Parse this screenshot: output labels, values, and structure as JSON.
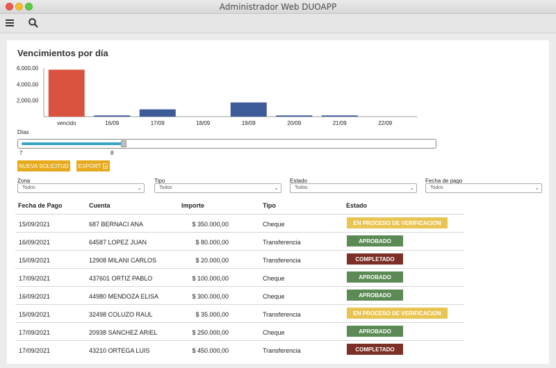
{
  "window": {
    "title": "Administrador Web DUOAPP"
  },
  "toolbar": {
    "menu_icon": "hamburger-icon",
    "search_icon": "search-icon"
  },
  "card": {
    "title": "Vencimientos por día"
  },
  "chart_data": {
    "type": "bar",
    "categories": [
      "vencido",
      "16/09",
      "17/09",
      "18/09",
      "19/09",
      "20/09",
      "21/09",
      "22/09"
    ],
    "values": [
      5800,
      150,
      900,
      0,
      1750,
      150,
      150,
      0
    ],
    "colors": [
      "#d9533f",
      "#3d5a99",
      "#3d5a99",
      "#3d5a99",
      "#3d5a99",
      "#3d5a99",
      "#3d5a99",
      "#3d5a99"
    ],
    "yticks": [
      {
        "value": 2000,
        "label": "2,000,00"
      },
      {
        "value": 4000,
        "label": "4,000,00"
      },
      {
        "value": 6000,
        "label": "6,000,00"
      }
    ],
    "ylim": [
      0,
      6000
    ],
    "grid": false,
    "legend": "none"
  },
  "slider": {
    "label": "Días",
    "min_label": "7",
    "max_label": "8",
    "fill_fraction": 0.24
  },
  "actions": {
    "new_request": "NUEVA SOLICITUD",
    "export": "EXPORT",
    "export_icon": "file-icon"
  },
  "filters": [
    {
      "label": "Zona",
      "value": "Todos"
    },
    {
      "label": "Tipo",
      "value": "Todos"
    },
    {
      "label": "Estado",
      "value": "Todos"
    },
    {
      "label": "Fecha de pago",
      "value": "Todos"
    }
  ],
  "table": {
    "headers": [
      "Fecha de Pago",
      "Cuenta",
      "Importe",
      "Tipo",
      "Estado"
    ],
    "rows": [
      {
        "fecha": "15/09/2021",
        "cuenta": "687 BERNACI ANA",
        "importe": "$ 350.000,00",
        "tipo": "Cheque",
        "estado": "EN PROCESO DE VERIFICACION",
        "estado_color": "#e9c453"
      },
      {
        "fecha": "16/09/2021",
        "cuenta": "64587 LOPEZ JUAN",
        "importe": "$ 80.000,00",
        "tipo": "Transferencia",
        "estado": "APROBADO",
        "estado_color": "#5b8a55"
      },
      {
        "fecha": "15/09/2021",
        "cuenta": "12908 MILANI CARLOS",
        "importe": "$ 20.000,00",
        "tipo": "Transferencia",
        "estado": "COMPLETADO",
        "estado_color": "#7c2f26"
      },
      {
        "fecha": "17/09/2021",
        "cuenta": "437601 ORTIZ PABLO",
        "importe": "$ 100.000,00",
        "tipo": "Cheque",
        "estado": "APROBADO",
        "estado_color": "#5b8a55"
      },
      {
        "fecha": "16/09/2021",
        "cuenta": "44980 MENDOZA ELISA",
        "importe": "$ 300.000,00",
        "tipo": "Cheque",
        "estado": "APROBADO",
        "estado_color": "#5b8a55"
      },
      {
        "fecha": "15/09/2021",
        "cuenta": "32498 COLUZO RAUL",
        "importe": "$ 35.000,00",
        "tipo": "Transferencia",
        "estado": "EN PROCESO DE VERIFICACION",
        "estado_color": "#e9c453"
      },
      {
        "fecha": "17/09/2021",
        "cuenta": "20938 SANCHEZ ARIEL",
        "importe": "$ 250.000,00",
        "tipo": "Cheque",
        "estado": "APROBADO",
        "estado_color": "#5b8a55"
      },
      {
        "fecha": "17/09/2021",
        "cuenta": "43210 ORTEGA LUIS",
        "importe": "$ 450.000,00",
        "tipo": "Transferencia",
        "estado": "COMPLETADO",
        "estado_color": "#7c2f26"
      }
    ]
  }
}
